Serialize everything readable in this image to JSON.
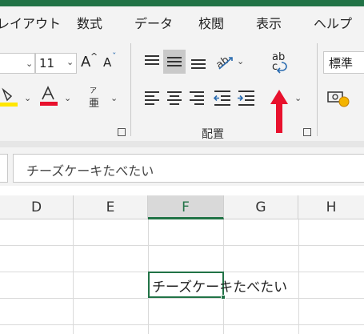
{
  "tabs": [
    "レイアウト",
    "数式",
    "データ",
    "校閲",
    "表示",
    "ヘルプ"
  ],
  "font": {
    "size": "11",
    "grow_glyph": "A",
    "shrink_glyph": "A",
    "phonetic_top": "ア",
    "phonetic_bottom": "亜"
  },
  "alignment": {
    "group_label": "配置",
    "wrap_text_top": "ab",
    "wrap_text_bottom": "c"
  },
  "number_format": {
    "value": "標準"
  },
  "formula_bar": {
    "content": "チーズケーキたべたい"
  },
  "columns": [
    "D",
    "E",
    "F",
    "G",
    "H"
  ],
  "active_column": "F",
  "cell": {
    "content": "チーズケーキたべたい"
  },
  "colors": {
    "accent": "#217346",
    "annotation_arrow": "#e8112d",
    "fill_yellow": "#ffe600",
    "font_red": "#e8112d"
  }
}
